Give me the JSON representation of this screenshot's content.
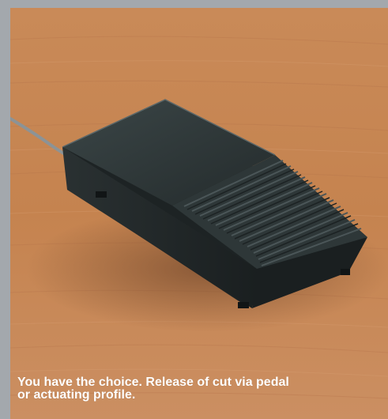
{
  "caption": {
    "line1": "You have the choice. Release of cut via pedal",
    "line2": "or actuating profile."
  },
  "colors": {
    "frame": "#a3a8ad",
    "wood": "#c98b5a",
    "pedal": "#2f3738",
    "caption_text": "#ffffff"
  }
}
